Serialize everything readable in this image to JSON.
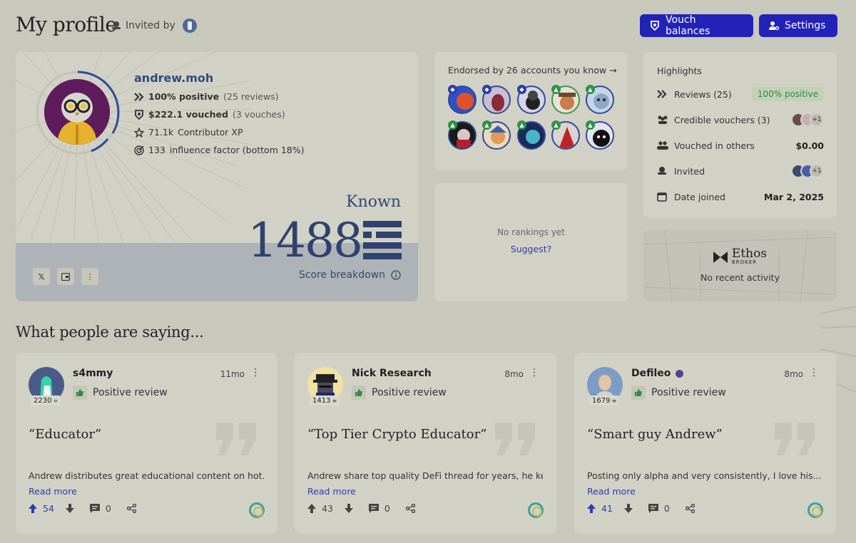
{
  "header": {
    "title": "My profile",
    "invited_label": "Invited by",
    "vouch_button": "Vouch balances",
    "settings_button": "Settings"
  },
  "profile": {
    "username": "andrew.moh",
    "positive_pct": "100% positive",
    "positive_reviews": "(25 reviews)",
    "vouched_amount": "$222.1 vouched",
    "vouched_count": "(3 vouches)",
    "xp_value": "71.1k",
    "xp_label": "Contributor XP",
    "influence_value": "133",
    "influence_label": "influence factor (bottom 18%)",
    "level": "Known",
    "score": "1488",
    "score_breakdown": "Score breakdown"
  },
  "endorsed": {
    "prefix": "Endorsed",
    "text": "by 26 accounts you know →"
  },
  "rankings": {
    "empty_text": "No rankings yet",
    "suggest_link": "Suggest?"
  },
  "highlights": {
    "title": "Highlights",
    "rows": [
      {
        "label": "Reviews (25)",
        "value": "100% positive",
        "icon": "reviews-icon"
      },
      {
        "label": "Credible vouchers (3)",
        "value": "+1",
        "icon": "vouchers-icon"
      },
      {
        "label": "Vouched in others",
        "value": "$0.00",
        "icon": "people-icon"
      },
      {
        "label": "Invited",
        "value": "+1",
        "icon": "invited-icon"
      },
      {
        "label": "Date joined",
        "value": "Mar 2, 2025",
        "icon": "calendar-icon"
      }
    ]
  },
  "broker": {
    "name": "Ethos",
    "sub": "BROKER",
    "empty_text": "No recent activity"
  },
  "section_title": "What people are saying...",
  "reviews": [
    {
      "author": "s4mmy",
      "score": "2230",
      "time": "11mo",
      "type": "Positive review",
      "quote": "“Educator”",
      "body": "Andrew distributes great educational content on hot...",
      "read_more": "Read more",
      "upvotes": "54",
      "comments": "0"
    },
    {
      "author": "Nick Research",
      "score": "1413",
      "time": "8mo",
      "type": "Positive review",
      "quote": "“Top Tier Crypto Educator”",
      "body": "Andrew share top quality DeFi thread for years, he keep...",
      "read_more": "Read more",
      "upvotes": "43",
      "comments": "0"
    },
    {
      "author": "Defileo",
      "score": "1679",
      "time": "8mo",
      "type": "Positive review",
      "quote": "“Smart guy Andrew”",
      "body": "Posting only alpha and very consistently, I love his...",
      "read_more": "Read more",
      "upvotes": "41",
      "comments": "0"
    }
  ],
  "colors": {
    "accent": "#2222b8",
    "score_blue": "#2f426e",
    "positive_green": "#2e8a3e",
    "background": "#c9c8bd"
  }
}
